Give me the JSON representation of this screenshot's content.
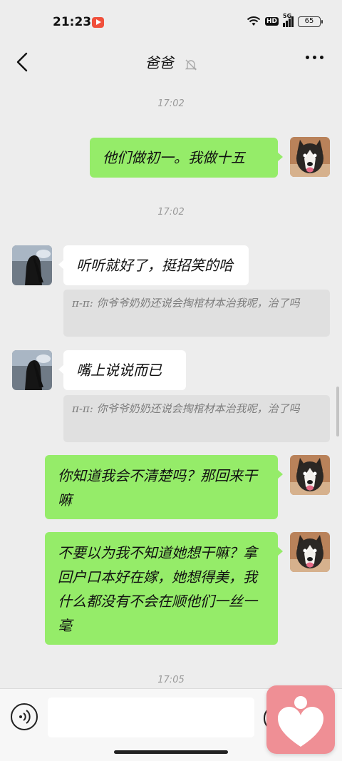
{
  "status": {
    "time": "21:23",
    "hd": "HD",
    "net": "5G",
    "battery": "65"
  },
  "nav": {
    "title": "爸爸"
  },
  "messages": {
    "t1": "17:02",
    "m1": "他们做初一。我做十五",
    "t2": "17:02",
    "m2": "听听就好了，挺招笑的哈",
    "q2": "π-π: 你爷爷奶奶还说会掏棺材本治我呢，治了吗",
    "m3": "嘴上说说而已",
    "q3": "π-π: 你爷爷奶奶还说会掏棺材本治我呢，治了吗",
    "m4": "你知道我会不清楚吗？那回来干嘛",
    "m5": "不要以为我不知道她想干嘛？拿回户口本好在嫁，她想得美，我什么都没有不会在顺他们一丝一毫",
    "t3": "17:05"
  },
  "colors": {
    "sent_bubble": "#95ec69",
    "received_bubble": "#ffffff",
    "background": "#ededed",
    "float_app": "#ef8f95"
  },
  "icons": [
    "back-arrow-icon",
    "mute-bell-icon",
    "more-icon",
    "voice-icon",
    "emoji-icon",
    "heart-app-icon"
  ]
}
